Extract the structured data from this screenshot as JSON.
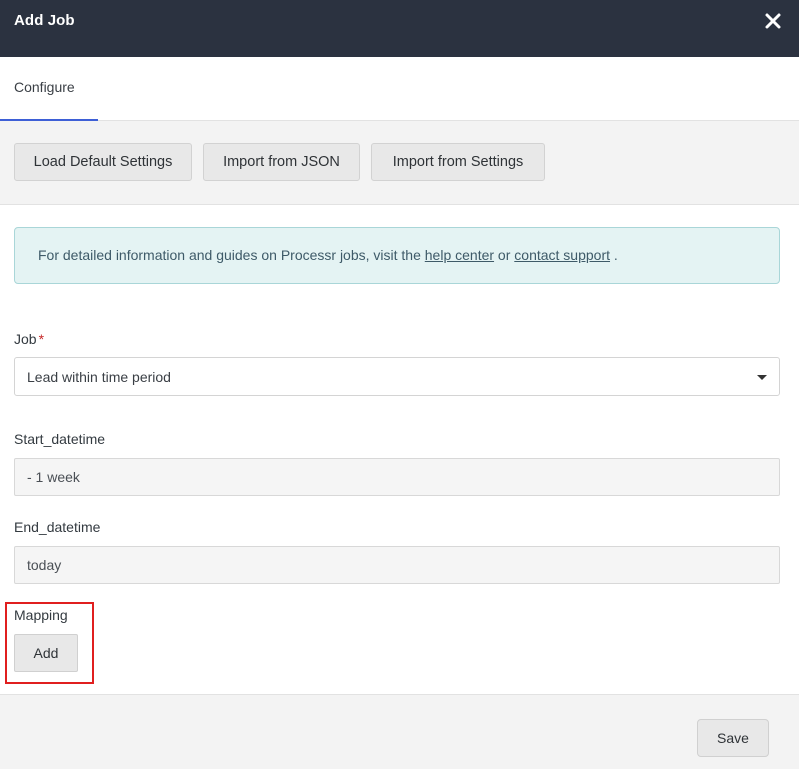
{
  "header": {
    "title": "Add Job",
    "close_icon": "close-icon"
  },
  "tabs": [
    {
      "label": "Configure",
      "active": true
    }
  ],
  "toolbar": {
    "load_default": "Load Default Settings",
    "import_json": "Import from JSON",
    "import_settings": "Import from Settings"
  },
  "info": {
    "prefix": "For detailed information and guides on Processr jobs, visit the ",
    "help_link": "help center",
    "middle": " or ",
    "support_link": "contact support",
    "suffix": " ."
  },
  "form": {
    "job_label": "Job",
    "required_mark": "*",
    "job_value": "Lead within time period",
    "start_label": "Start_datetime",
    "start_value": "- 1 week",
    "end_label": "End_datetime",
    "end_value": "today",
    "mapping_label": "Mapping",
    "add_label": "Add"
  },
  "footer": {
    "save_label": "Save"
  },
  "colors": {
    "header_bg": "#2b3240",
    "tab_accent": "#3d5fd6",
    "info_bg": "#e4f3f3",
    "info_border": "#a9d6d8",
    "required": "#c62828",
    "highlight": "#e01f1f"
  }
}
